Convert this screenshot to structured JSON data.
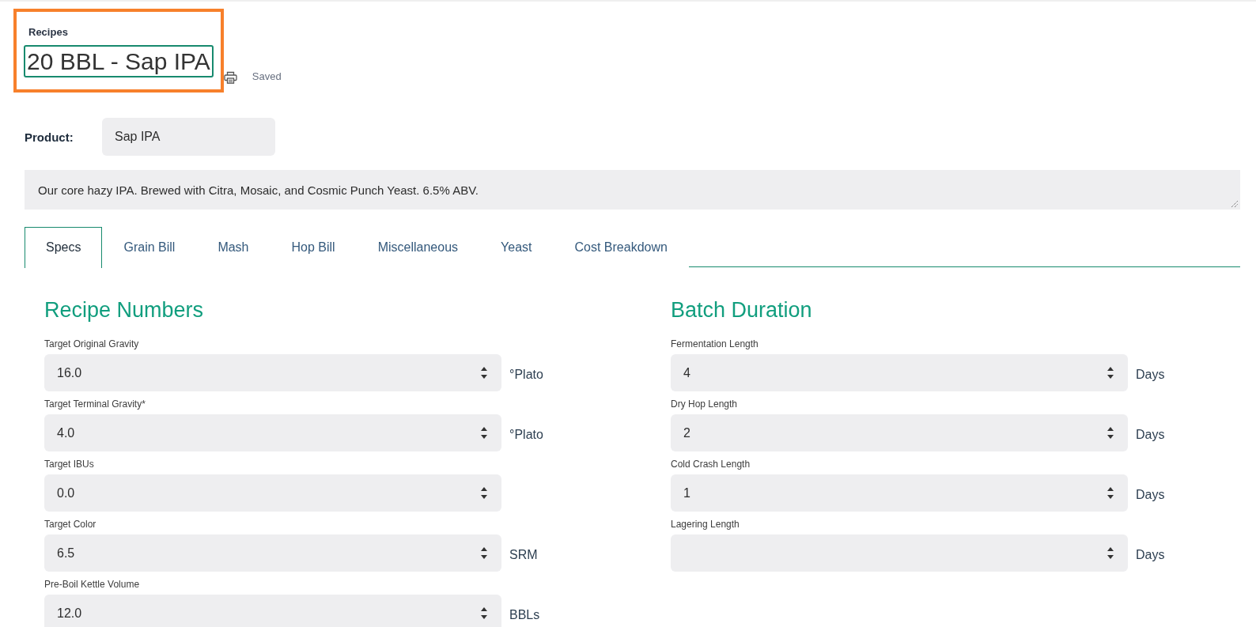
{
  "header": {
    "breadcrumb": "Recipes",
    "title_field": {
      "value": "20 BBL - Sap IPA",
      "focused": true
    },
    "highlighted": true,
    "save_status": "Saved"
  },
  "product": {
    "label": "Product:",
    "value": "Sap IPA"
  },
  "description": {
    "value": "Our core hazy IPA. Brewed with Citra, Mosaic, and Cosmic Punch Yeast. 6.5% ABV."
  },
  "tabs": [
    {
      "label": "Specs",
      "selected": true
    },
    {
      "label": "Grain Bill",
      "selected": false
    },
    {
      "label": "Mash",
      "selected": false
    },
    {
      "label": "Hop Bill",
      "selected": false
    },
    {
      "label": "Miscellaneous",
      "selected": false
    },
    {
      "label": "Yeast",
      "selected": false
    },
    {
      "label": "Cost Breakdown",
      "selected": false
    }
  ],
  "sections": [
    {
      "title": "Recipe Numbers",
      "fields": [
        {
          "label": "Target Original Gravity",
          "value": "16.0",
          "unit": "°Plato"
        },
        {
          "label": "Target Terminal Gravity*",
          "value": "4.0",
          "unit": "°Plato"
        },
        {
          "label": "Target IBUs",
          "value": "0.0"
        },
        {
          "label": "Target Color",
          "value": "6.5",
          "unit": "SRM"
        },
        {
          "label": "Pre-Boil Kettle Volume",
          "value": "12.0",
          "unit": "BBLs"
        }
      ]
    },
    {
      "title": "Batch Duration",
      "fields": [
        {
          "label": "Fermentation Length",
          "value": "4",
          "unit": "Days"
        },
        {
          "label": "Dry Hop Length",
          "value": "2",
          "unit": "Days"
        },
        {
          "label": "Cold Crash Length",
          "value": "1",
          "unit": "Days"
        },
        {
          "label": "Lagering Length",
          "unit": "Days"
        }
      ]
    }
  ]
}
